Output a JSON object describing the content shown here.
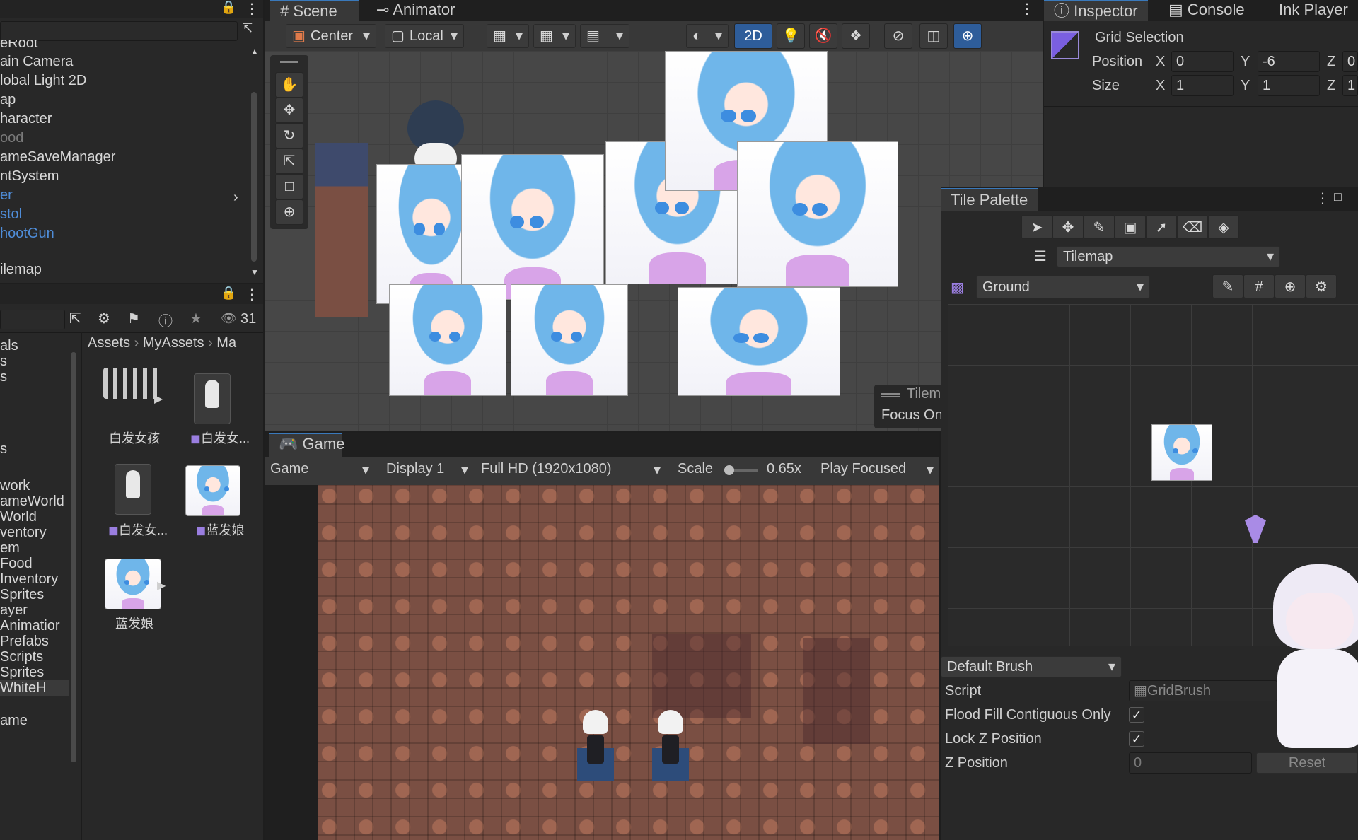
{
  "hierarchy": {
    "items": [
      {
        "label": "eRoot",
        "style": "normal"
      },
      {
        "label": "ain Camera",
        "style": "normal"
      },
      {
        "label": "lobal Light 2D",
        "style": "normal"
      },
      {
        "label": "ap",
        "style": "normal"
      },
      {
        "label": "haracter",
        "style": "normal"
      },
      {
        "label": "ood",
        "style": "dim"
      },
      {
        "label": "ameSaveManager",
        "style": "normal"
      },
      {
        "label": "ntSystem",
        "style": "normal"
      },
      {
        "label": "er",
        "style": "blue"
      },
      {
        "label": "stol",
        "style": "blue"
      },
      {
        "label": "hootGun",
        "style": "blue"
      },
      {
        "label": "ilemap",
        "style": "normal"
      }
    ]
  },
  "project": {
    "hidden_count": "31",
    "breadcrumb": [
      "Assets",
      "MyAssets",
      "Ma"
    ],
    "folders": [
      "als",
      "s",
      "s",
      "s",
      "work",
      "ameWorld",
      "World",
      "ventory",
      "em",
      "Food",
      "Inventory",
      "Sprites",
      "ayer",
      "Animatior",
      "Prefabs",
      "Scripts",
      "Sprites",
      "WhiteH",
      "ame"
    ],
    "assets": [
      "白发女孩",
      "白发女...",
      "白发女...",
      "蓝发娘",
      "蓝发娘"
    ]
  },
  "scene": {
    "tab_scene": "Scene",
    "tab_animator": "Animator",
    "pivot_mode": "Center",
    "pivot_rotation": "Local",
    "mode_2d": "2D",
    "overlay_title": "Tilem",
    "overlay_focus": "Focus On"
  },
  "game": {
    "tab": "Game",
    "view_select": "Game",
    "display": "Display 1",
    "resolution": "Full HD (1920x1080)",
    "scale_label": "Scale",
    "scale_value": "0.65x",
    "play_mode": "Play Focused"
  },
  "inspector": {
    "tab_inspector": "Inspector",
    "tab_console": "Console",
    "tab_ink": "Ink Player",
    "title": "Grid Selection",
    "position_label": "Position",
    "size_label": "Size",
    "axes": [
      "X",
      "Y",
      "Z"
    ],
    "position": [
      "0",
      "-6",
      "0"
    ],
    "size": [
      "1",
      "1",
      "1"
    ]
  },
  "tile_palette": {
    "title": "Tile Palette",
    "tilemap": "Tilemap",
    "palette": "Ground",
    "brush": "Default Brush",
    "script_label": "Script",
    "script_value": "GridBrush",
    "flood_fill_label": "Flood Fill Contiguous Only",
    "lock_z_label": "Lock Z Position",
    "z_position_label": "Z Position",
    "z_position_value": "0",
    "reset_label": "Reset",
    "flood_fill_checked": true,
    "lock_z_checked": true
  },
  "colors": {
    "accent": "#2e5d9a",
    "selection_blue": "#4f8dd9",
    "ground_brown": "#7a4f43"
  }
}
